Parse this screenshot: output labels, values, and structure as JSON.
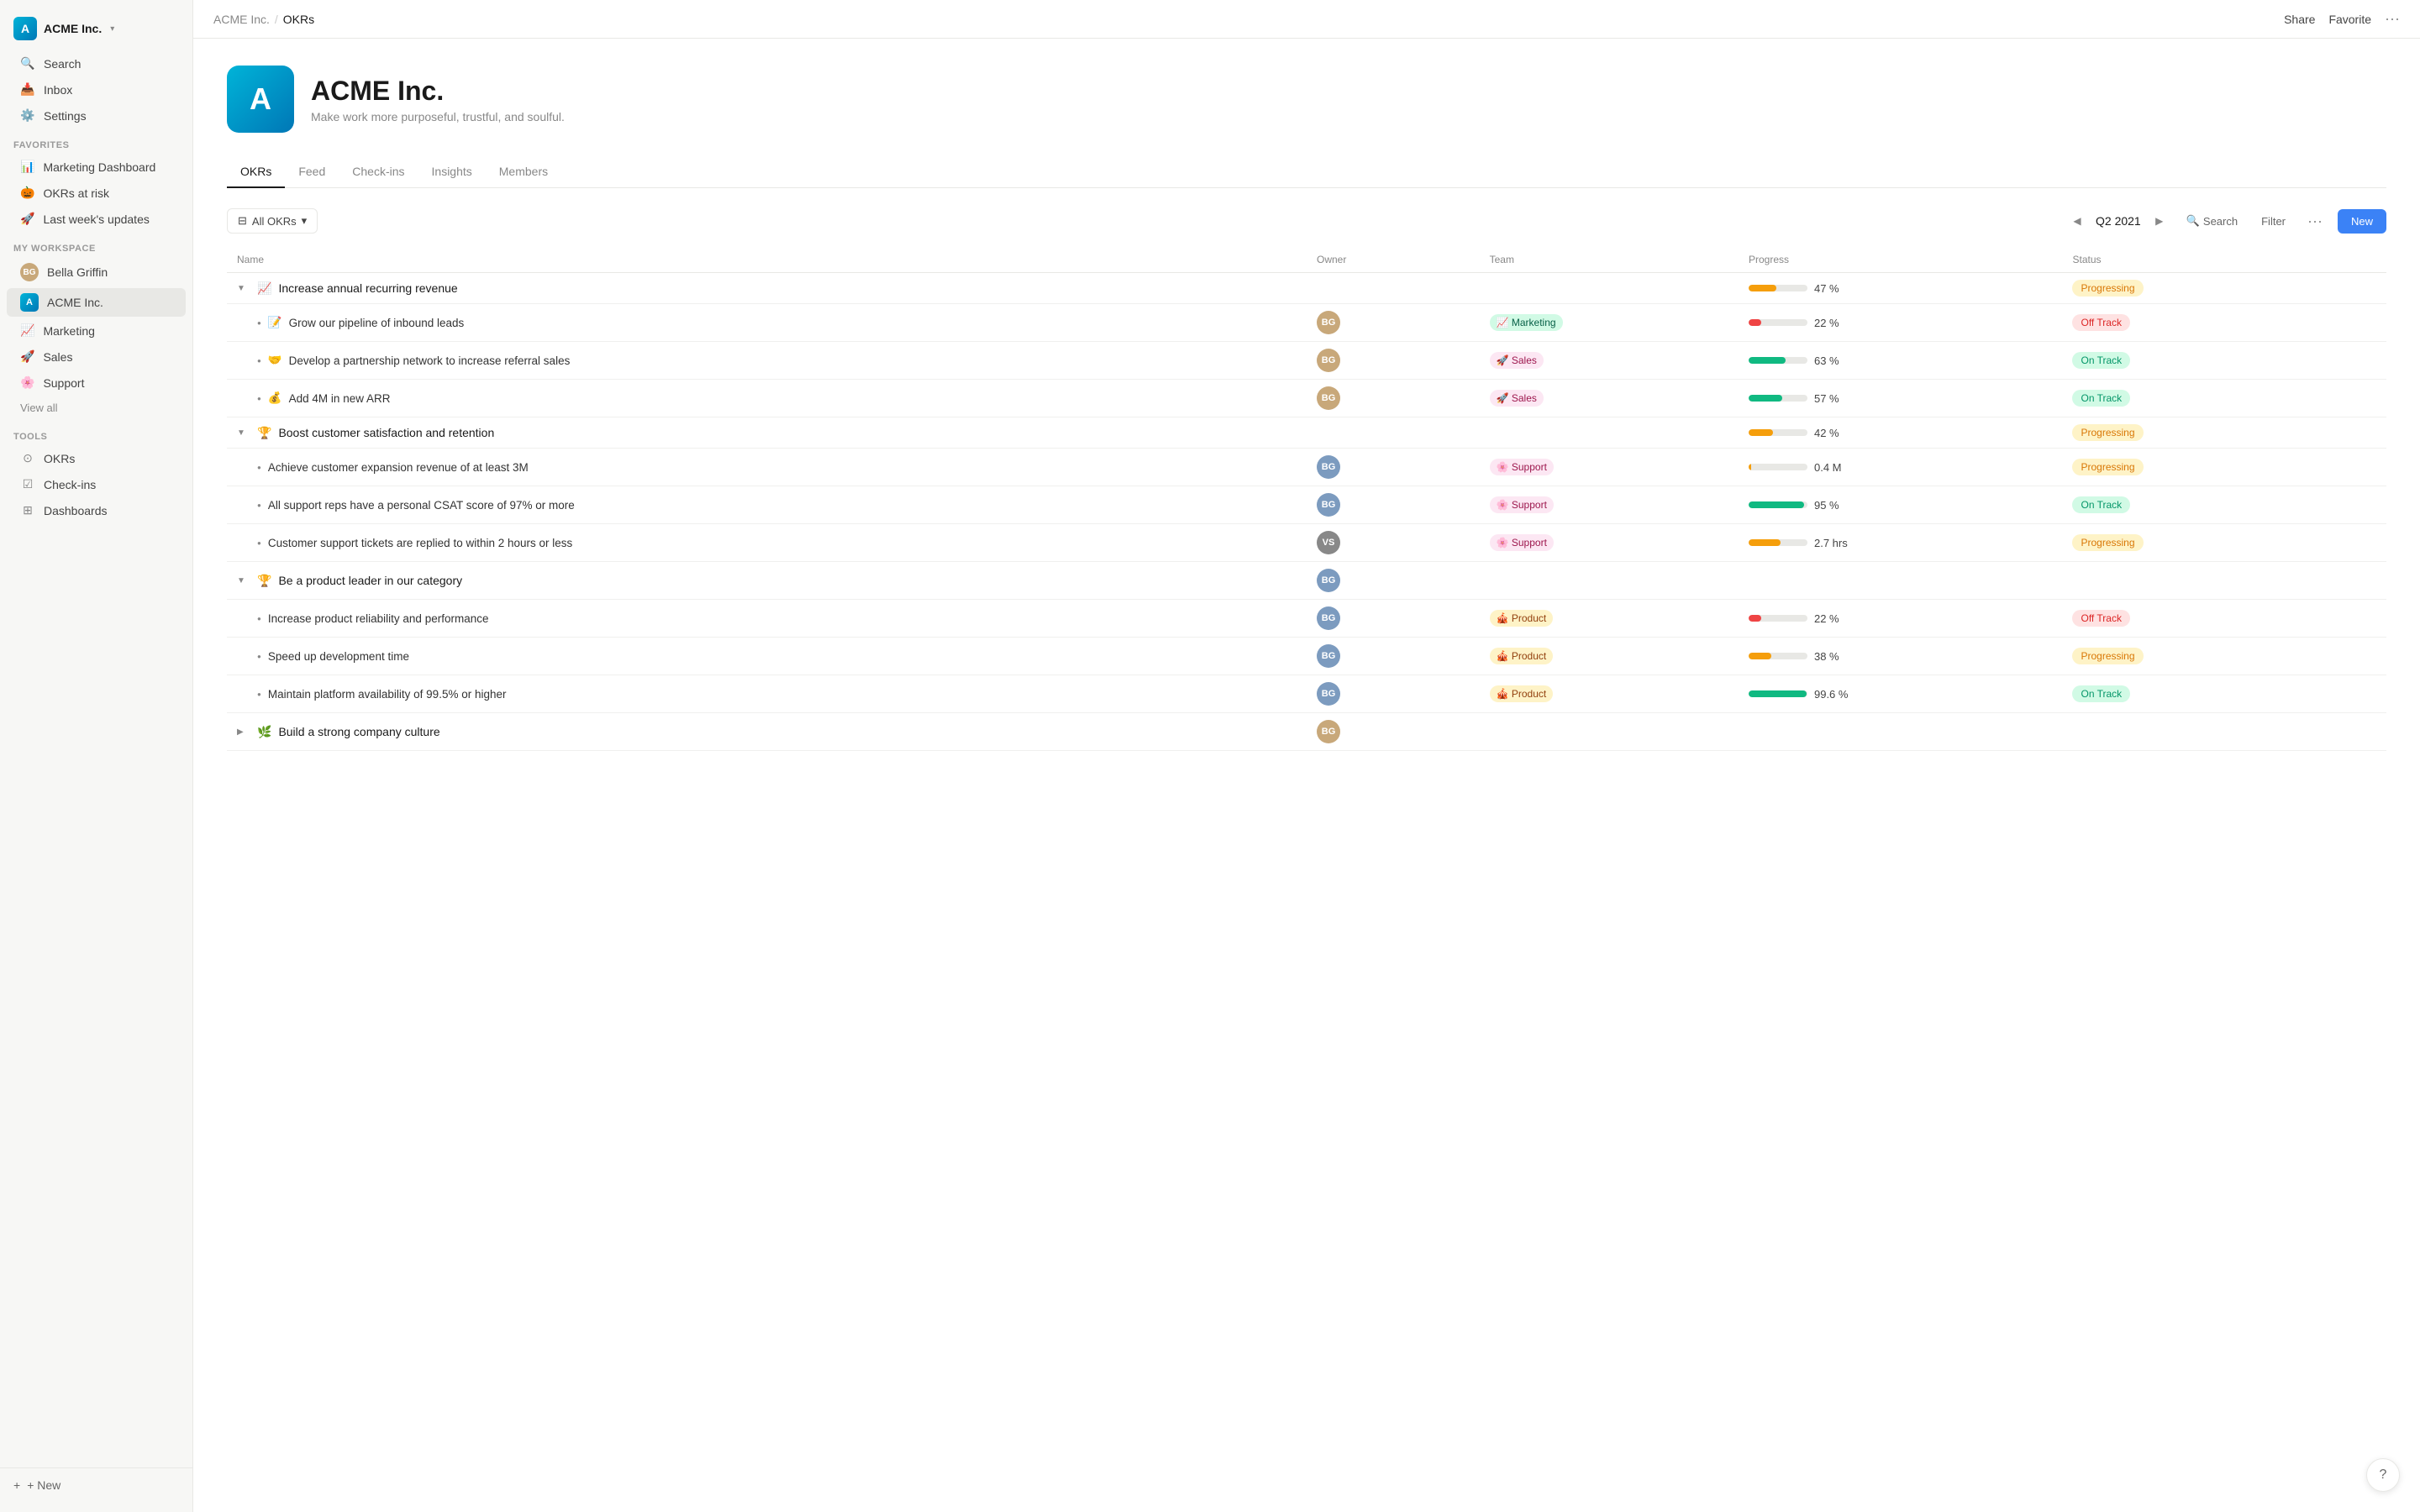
{
  "workspace": {
    "name": "ACME Inc.",
    "logo_letter": "A",
    "chevron": "▾"
  },
  "nav": {
    "search": "Search",
    "inbox": "Inbox",
    "settings": "Settings"
  },
  "favorites": {
    "label": "FAVORITES",
    "items": [
      {
        "icon": "📊",
        "label": "Marketing Dashboard"
      },
      {
        "icon": "🎃",
        "label": "OKRs at risk"
      },
      {
        "icon": "🚀",
        "label": "Last week's updates"
      }
    ]
  },
  "my_workspace": {
    "label": "MY WORKSPACE",
    "items": [
      {
        "type": "person",
        "label": "Bella Griffin"
      },
      {
        "type": "acme",
        "label": "ACME Inc.",
        "active": true
      },
      {
        "type": "emoji",
        "icon": "📈",
        "label": "Marketing"
      },
      {
        "type": "emoji",
        "icon": "🚀",
        "label": "Sales"
      },
      {
        "type": "emoji",
        "icon": "🌸",
        "label": "Support"
      }
    ],
    "view_all": "View all"
  },
  "tools": {
    "label": "TOOLS",
    "items": [
      {
        "icon": "⊙",
        "label": "OKRs"
      },
      {
        "icon": "☑",
        "label": "Check-ins"
      },
      {
        "icon": "⊞",
        "label": "Dashboards"
      }
    ]
  },
  "sidebar_bottom": {
    "label": "+ New"
  },
  "topbar": {
    "breadcrumb_parent": "ACME Inc.",
    "breadcrumb_sep": "/",
    "breadcrumb_current": "OKRs",
    "share": "Share",
    "favorite": "Favorite",
    "more": "···"
  },
  "company": {
    "logo_letter": "A",
    "name": "ACME Inc.",
    "tagline": "Make work more purposeful, trustful, and soulful."
  },
  "tabs": [
    {
      "label": "OKRs",
      "active": true
    },
    {
      "label": "Feed"
    },
    {
      "label": "Check-ins"
    },
    {
      "label": "Insights"
    },
    {
      "label": "Members"
    }
  ],
  "okr_toolbar": {
    "filter_label": "All OKRs",
    "period": "Q2 2021",
    "search": "Search",
    "filter": "Filter",
    "more": "···",
    "new": "New"
  },
  "table": {
    "headers": [
      "Name",
      "Owner",
      "Team",
      "Progress",
      "Status"
    ],
    "objectives": [
      {
        "id": "obj1",
        "icon": "📈",
        "name": "Increase annual recurring revenue",
        "progress_pct": 47,
        "progress_label": "47 %",
        "progress_color": "#f59e0b",
        "status": "Progressing",
        "status_class": "status-progressing",
        "expanded": true,
        "key_results": [
          {
            "icon": "📝",
            "name": "Grow our pipeline of inbound leads",
            "owner_initials": "BG",
            "owner_class": "avatar-bg-1",
            "team": "Marketing",
            "team_icon": "📈",
            "team_class": "team-marketing",
            "progress_pct": 22,
            "progress_label": "22 %",
            "progress_color": "#ef4444",
            "status": "Off Track",
            "status_class": "status-off-track"
          },
          {
            "icon": "🤝",
            "name": "Develop a partnership network to increase referral sales",
            "owner_initials": "BG",
            "owner_class": "avatar-bg-1",
            "team": "Sales",
            "team_icon": "🚀",
            "team_class": "team-sales",
            "progress_pct": 63,
            "progress_label": "63 %",
            "progress_color": "#10b981",
            "status": "On Track",
            "status_class": "status-on-track"
          },
          {
            "icon": "💰",
            "name": "Add 4M in new ARR",
            "owner_initials": "BG",
            "owner_class": "avatar-bg-1",
            "team": "Sales",
            "team_icon": "🚀",
            "team_class": "team-sales",
            "progress_pct": 57,
            "progress_label": "57 %",
            "progress_color": "#10b981",
            "status": "On Track",
            "status_class": "status-on-track"
          }
        ]
      },
      {
        "id": "obj2",
        "icon": "🏆",
        "name": "Boost customer satisfaction and retention",
        "progress_pct": 42,
        "progress_label": "42 %",
        "progress_color": "#f59e0b",
        "status": "Progressing",
        "status_class": "status-progressing",
        "expanded": true,
        "key_results": [
          {
            "name": "Achieve customer expansion revenue of at least 3M",
            "owner_initials": "BG",
            "owner_class": "avatar-bg-2",
            "team": "Support",
            "team_icon": "🌸",
            "team_class": "team-support",
            "progress_pct": 4,
            "progress_label": "0.4 M",
            "progress_color": "#f59e0b",
            "status": "Progressing",
            "status_class": "status-progressing"
          },
          {
            "name": "All support reps have a personal CSAT score of 97% or more",
            "owner_initials": "BG",
            "owner_class": "avatar-bg-2",
            "team": "Support",
            "team_icon": "🌸",
            "team_class": "team-support",
            "progress_pct": 95,
            "progress_label": "95 %",
            "progress_color": "#10b981",
            "status": "On Track",
            "status_class": "status-on-track"
          },
          {
            "name": "Customer support tickets are replied to within 2 hours or less",
            "owner_initials": "VS",
            "owner_class": "avatar-vs",
            "team": "Support",
            "team_icon": "🌸",
            "team_class": "team-support",
            "progress_pct": 55,
            "progress_label": "2.7 hrs",
            "progress_color": "#f59e0b",
            "status": "Progressing",
            "status_class": "status-progressing"
          }
        ]
      },
      {
        "id": "obj3",
        "icon": "🏆",
        "name": "Be a product leader in our category",
        "owner_initials": "BG",
        "owner_class": "avatar-bg-2",
        "progress_pct": 0,
        "progress_label": "",
        "progress_color": "#e8e8e5",
        "status": "",
        "status_class": "",
        "expanded": true,
        "key_results": [
          {
            "name": "Increase product reliability and performance",
            "owner_initials": "BG",
            "owner_class": "avatar-bg-2",
            "team": "Product",
            "team_icon": "🎪",
            "team_class": "team-product",
            "progress_pct": 22,
            "progress_label": "22 %",
            "progress_color": "#ef4444",
            "status": "Off Track",
            "status_class": "status-off-track"
          },
          {
            "name": "Speed up development time",
            "owner_initials": "BG",
            "owner_class": "avatar-bg-2",
            "team": "Product",
            "team_icon": "🎪",
            "team_class": "team-product",
            "progress_pct": 38,
            "progress_label": "38 %",
            "progress_color": "#f59e0b",
            "status": "Progressing",
            "status_class": "status-progressing"
          },
          {
            "name": "Maintain platform availability of 99.5% or higher",
            "owner_initials": "BG",
            "owner_class": "avatar-bg-2",
            "team": "Product",
            "team_icon": "🎪",
            "team_class": "team-product",
            "progress_pct": 99,
            "progress_label": "99.6 %",
            "progress_color": "#10b981",
            "status": "On Track",
            "status_class": "status-on-track"
          }
        ]
      },
      {
        "id": "obj4",
        "icon": "🌿",
        "name": "Build a strong company culture",
        "owner_initials": "BG",
        "owner_class": "avatar-bg-1",
        "progress_pct": 0,
        "progress_label": "",
        "progress_color": "#e8e8e5",
        "status": "",
        "status_class": "",
        "expanded": false,
        "key_results": []
      }
    ]
  },
  "help": "?"
}
